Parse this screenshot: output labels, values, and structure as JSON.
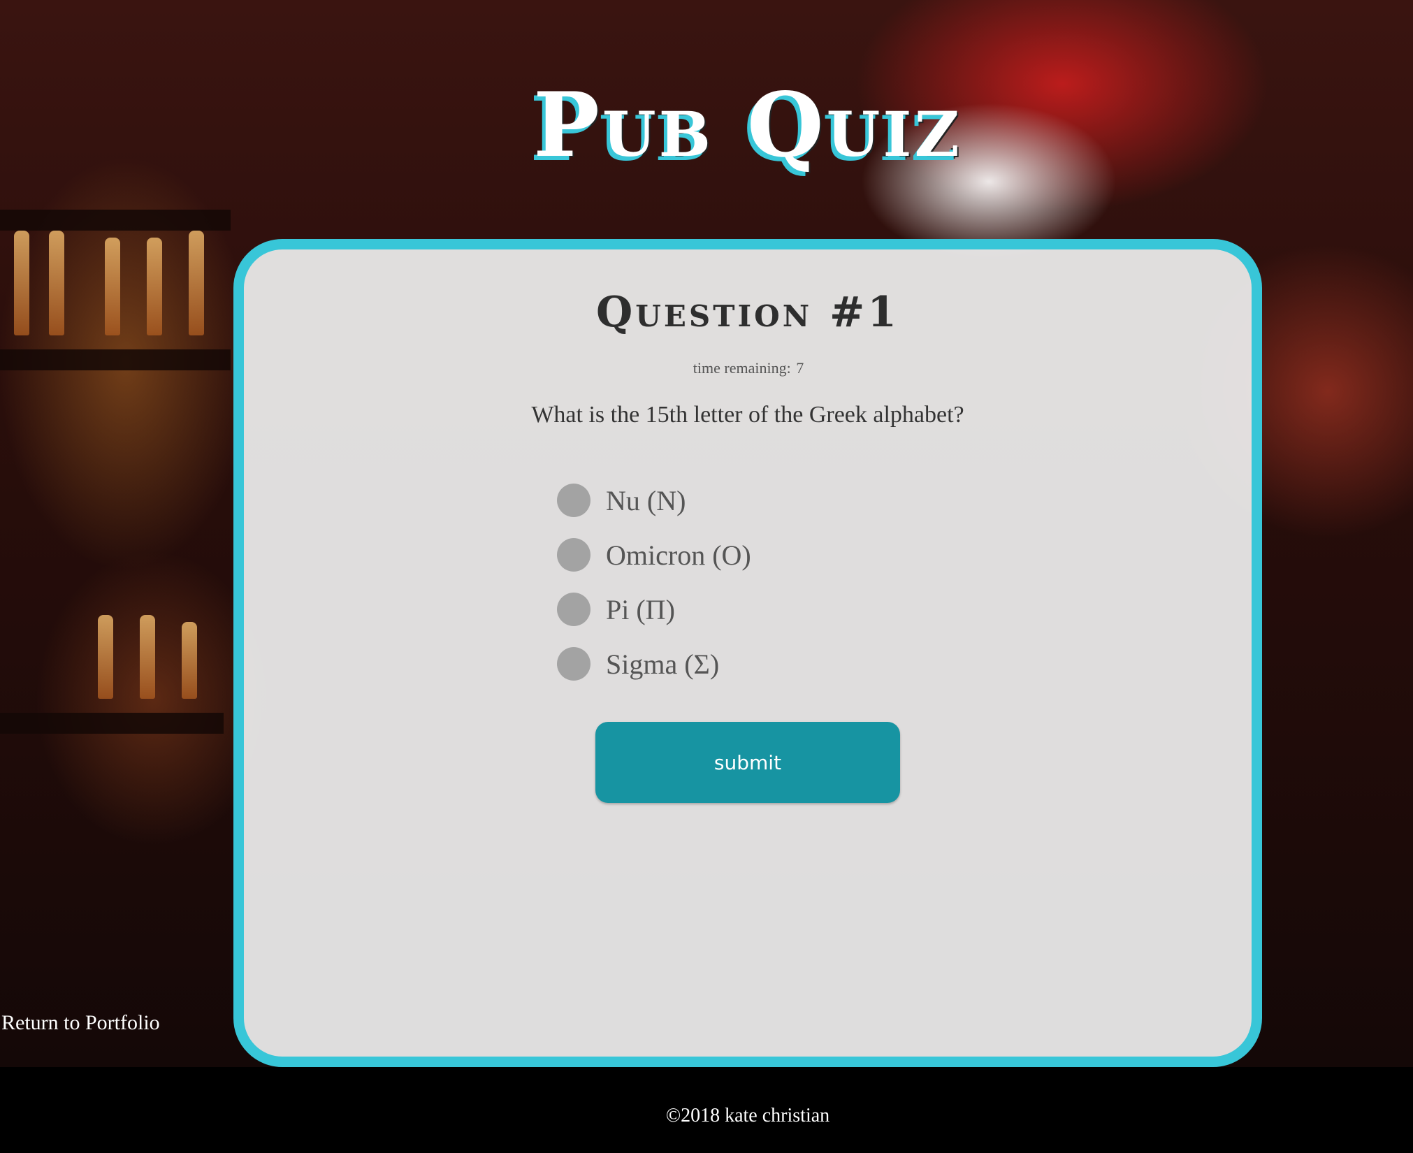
{
  "header": {
    "title": "Pub Quiz"
  },
  "quiz": {
    "question_title": "Question #1",
    "timer_label": "time remaining:",
    "timer_value": "7",
    "question_text": "What is the 15th letter of the Greek alphabet?",
    "options": [
      {
        "label": "Nu (Ν)"
      },
      {
        "label": "Omicron (Ο)"
      },
      {
        "label": "Pi (Π)"
      },
      {
        "label": "Sigma (Σ)"
      }
    ],
    "submit_label": "submit"
  },
  "links": {
    "return_label": "Return to Portfolio"
  },
  "footer": {
    "copyright": "©2018 kate christian"
  },
  "colors": {
    "accent": "#38c6d8",
    "button": "#1794a2",
    "radio": "#a3a3a3",
    "card_bg": "#eeeeee",
    "footer_bg": "#000000"
  }
}
